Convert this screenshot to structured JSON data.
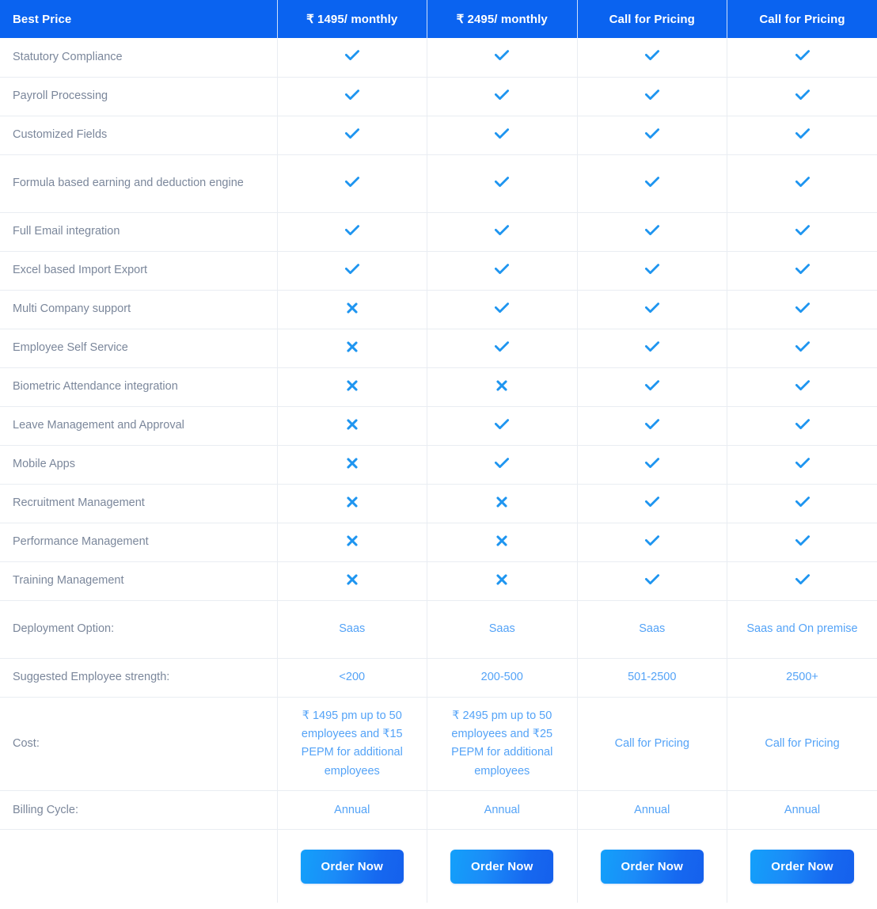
{
  "table": {
    "header": {
      "feature_label": "Best Price",
      "plans": [
        "₹ 1495/ monthly",
        "₹ 2495/ monthly",
        "Call for Pricing",
        "Call for Pricing"
      ]
    },
    "feature_rows": [
      {
        "label": "Statutory Compliance",
        "marks": [
          "check",
          "check",
          "check",
          "check"
        ]
      },
      {
        "label": "Payroll Processing",
        "marks": [
          "check",
          "check",
          "check",
          "check"
        ]
      },
      {
        "label": "Customized Fields",
        "marks": [
          "check",
          "check",
          "check",
          "check"
        ]
      },
      {
        "label": "Formula based earning and deduction engine",
        "marks": [
          "check",
          "check",
          "check",
          "check"
        ]
      },
      {
        "label": "Full Email integration",
        "marks": [
          "check",
          "check",
          "check",
          "check"
        ]
      },
      {
        "label": "Excel based Import Export",
        "marks": [
          "check",
          "check",
          "check",
          "check"
        ]
      },
      {
        "label": "Multi Company support",
        "marks": [
          "cross",
          "check",
          "check",
          "check"
        ]
      },
      {
        "label": "Employee Self Service",
        "marks": [
          "cross",
          "check",
          "check",
          "check"
        ]
      },
      {
        "label": "Biometric Attendance integration",
        "marks": [
          "cross",
          "cross",
          "check",
          "check"
        ]
      },
      {
        "label": "Leave Management and Approval",
        "marks": [
          "cross",
          "check",
          "check",
          "check"
        ]
      },
      {
        "label": "Mobile Apps",
        "marks": [
          "cross",
          "check",
          "check",
          "check"
        ]
      },
      {
        "label": "Recruitment Management",
        "marks": [
          "cross",
          "cross",
          "check",
          "check"
        ]
      },
      {
        "label": "Performance Management",
        "marks": [
          "cross",
          "cross",
          "check",
          "check"
        ]
      },
      {
        "label": "Training Management",
        "marks": [
          "cross",
          "cross",
          "check",
          "check"
        ]
      }
    ],
    "deployment": {
      "label": "Deployment Option:",
      "values": [
        "Saas",
        "Saas",
        "Saas",
        "Saas and On premise"
      ]
    },
    "strength": {
      "label": "Suggested Employee strength:",
      "values": [
        "<200",
        "200-500",
        "501-2500",
        "2500+"
      ]
    },
    "cost": {
      "label": "Cost:",
      "values": [
        "₹ 1495 pm up to 50 employees and ₹15 PEPM for additional employees",
        "₹ 2495 pm up to 50 employees and ₹25 PEPM for additional employees",
        "Call for Pricing",
        "Call for Pricing"
      ]
    },
    "billing": {
      "label": "Billing Cycle:",
      "values": [
        "Annual",
        "Annual",
        "Annual",
        "Annual"
      ]
    },
    "order": {
      "label": "",
      "buttons": [
        "Order Now",
        "Order Now",
        "Order Now",
        "Order Now"
      ]
    },
    "icons": {
      "check": "check-icon",
      "cross": "cross-icon"
    },
    "colors": {
      "header_background": "#0a63f0",
      "header_text": "#ffffff",
      "feature_text": "#7b879b",
      "value_text": "#54a3f7",
      "check_mark": "#1e95f0",
      "cross_mark": "#1e95f0",
      "row_border": "#e9edf2",
      "button_gradient_start": "#13a0fa",
      "button_gradient_end": "#1560ec"
    }
  }
}
